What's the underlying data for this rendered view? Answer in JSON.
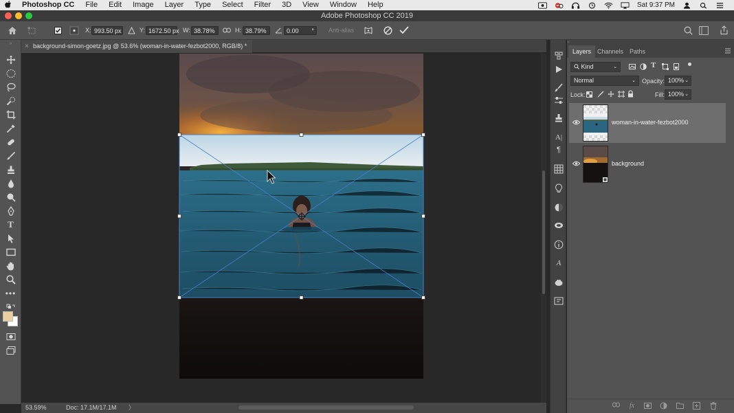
{
  "menubar": {
    "apple": "",
    "items": [
      "Photoshop CC",
      "File",
      "Edit",
      "Image",
      "Layer",
      "Type",
      "Select",
      "Filter",
      "3D",
      "View",
      "Window",
      "Help"
    ],
    "clock": "Sat 9:37 PM"
  },
  "window": {
    "title": "Adobe Photoshop CC 2019"
  },
  "options": {
    "x_label": "X:",
    "x_value": "993.50 px",
    "y_label": "Y:",
    "y_value": "1672.50 px",
    "w_label": "W:",
    "w_value": "38.78%",
    "h_label": "H:",
    "h_value": "38.79%",
    "angle_value": "0.00",
    "angle_unit": "°",
    "antialias_label": "Anti-alias"
  },
  "document": {
    "tab_title": "background-simon-goetz.jpg @ 53.6% (woman-in-water-fezbot2000, RGB/8) *"
  },
  "status": {
    "zoom": "53.59%",
    "doc": "Doc: 17.1M/17.1M",
    "arrow": "〉"
  },
  "layers_panel": {
    "tabs": [
      "Layers",
      "Channels",
      "Paths"
    ],
    "filter_kind": "Kind",
    "blend_mode": "Normal",
    "opacity_label": "Opacity:",
    "opacity_value": "100%",
    "lock_label": "Lock:",
    "fill_label": "Fill:",
    "fill_value": "100%",
    "layers": [
      {
        "name": "woman-in-water-fezbot2000",
        "visible": true,
        "selected": true
      },
      {
        "name": "background",
        "visible": true,
        "selected": false
      }
    ]
  },
  "colors": {
    "accent": "#1473e6",
    "panel": "#535353",
    "canvas_bg": "#282828"
  }
}
